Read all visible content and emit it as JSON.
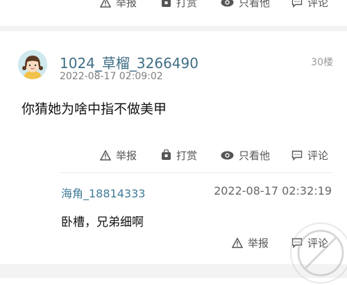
{
  "top_actions": [
    {
      "icon": "warning-triangle-icon",
      "label": "举报"
    },
    {
      "icon": "gift-bag-icon",
      "label": "打赏"
    },
    {
      "icon": "eye-icon",
      "label": "只看他"
    },
    {
      "icon": "comment-icon",
      "label": "评论"
    }
  ],
  "post": {
    "username": "1024_草榴_3266490",
    "timestamp": "2022-08-17 02:09:02",
    "floor": "30楼",
    "content": "你猜她为啥中指不做美甲",
    "actions": [
      {
        "icon": "warning-triangle-icon",
        "label": "举报"
      },
      {
        "icon": "gift-bag-icon",
        "label": "打赏"
      },
      {
        "icon": "eye-icon",
        "label": "只看他"
      },
      {
        "icon": "comment-icon",
        "label": "评论"
      }
    ]
  },
  "reply": {
    "username": "海角_18814333",
    "timestamp": "2022-08-17 02:32:19",
    "content": "卧槽，兄弟细啊",
    "actions": [
      {
        "icon": "warning-triangle-icon",
        "label": "举报"
      },
      {
        "icon": "comment-icon",
        "label": "评论"
      }
    ]
  },
  "colors": {
    "username": "#3f6d85",
    "reply_username": "#3f7c99",
    "divider": "#f3f3f3"
  }
}
